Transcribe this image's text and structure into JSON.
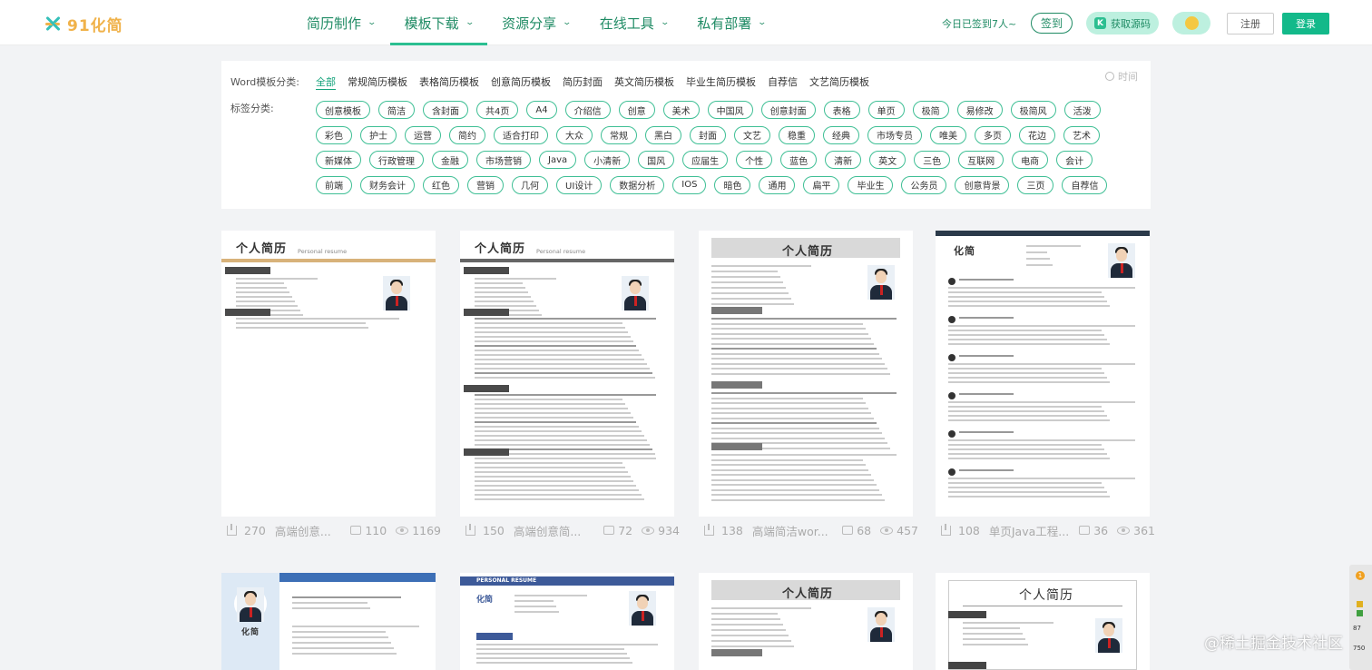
{
  "brand": {
    "logo_text": "91化简"
  },
  "nav": {
    "items": [
      {
        "label": "简历制作",
        "active": false
      },
      {
        "label": "模板下载",
        "active": true
      },
      {
        "label": "资源分享",
        "active": false
      },
      {
        "label": "在线工具",
        "active": false
      },
      {
        "label": "私有部署",
        "active": false
      }
    ]
  },
  "header": {
    "checkin_text": "今日已签到7人~",
    "checkin_button": "签到",
    "source_button": "获取源码",
    "register_button": "注册",
    "login_button": "登录"
  },
  "filter": {
    "word_label": "Word模板分类:",
    "tag_label": "标签分类:",
    "sort_label": "时间",
    "categories": [
      "全部",
      "常规简历模板",
      "表格简历模板",
      "创意简历模板",
      "简历封面",
      "英文简历模板",
      "毕业生简历模板",
      "自荐信",
      "文艺简历模板"
    ],
    "active_category": "全部",
    "tag_rows": [
      [
        "创意模板",
        "简洁",
        "含封面",
        "共4页",
        "A4",
        "介绍信",
        "创意",
        "美术",
        "中国风",
        "创意封面",
        "表格",
        "单页",
        "极简",
        "易修改",
        "极简风",
        "活泼"
      ],
      [
        "彩色",
        "护士",
        "运营",
        "简约",
        "适合打印",
        "大众",
        "常规",
        "黑白",
        "封面",
        "文艺",
        "稳重",
        "经典",
        "市场专员",
        "唯美",
        "多页",
        "花边",
        "艺术"
      ],
      [
        "新媒体",
        "行政管理",
        "金融",
        "市场营销",
        "Java",
        "小清新",
        "国风",
        "应届生",
        "个性",
        "蓝色",
        "清新",
        "英文",
        "三色",
        "互联网",
        "电商",
        "会计"
      ],
      [
        "前端",
        "财务会计",
        "红色",
        "营销",
        "几何",
        "UI设计",
        "数据分析",
        "IOS",
        "暗色",
        "通用",
        "扁平",
        "毕业生",
        "公务员",
        "创意背景",
        "三页",
        "自荐信"
      ]
    ]
  },
  "templates": [
    {
      "title_text": "个人简历",
      "subtitle": "Personal resume",
      "name": "高端创意...",
      "downloads": "270",
      "comments": "110",
      "views": "1169"
    },
    {
      "title_text": "个人简历",
      "subtitle": "Personal resume",
      "name": "高端创意简...",
      "downloads": "150",
      "comments": "72",
      "views": "934"
    },
    {
      "title_text": "个人简历",
      "subtitle": "",
      "name": "高端简洁wor...",
      "downloads": "138",
      "comments": "68",
      "views": "457"
    },
    {
      "title_text": "化简",
      "subtitle": "",
      "name": "单页Java工程...",
      "downloads": "108",
      "comments": "36",
      "views": "361"
    },
    {
      "title_text": "化简",
      "subtitle": "",
      "name": "",
      "downloads": "",
      "comments": "",
      "views": ""
    },
    {
      "title_text": "PERSONAL RESUME",
      "subtitle": "化简",
      "name": "",
      "downloads": "",
      "comments": "",
      "views": ""
    },
    {
      "title_text": "个人简历",
      "subtitle": "",
      "name": "",
      "downloads": "",
      "comments": "",
      "views": ""
    },
    {
      "title_text": "个人简历",
      "subtitle": "",
      "name": "",
      "downloads": "",
      "comments": "",
      "views": ""
    }
  ],
  "side_widget": {
    "badge": "1",
    "value1": "87",
    "value2": "750"
  },
  "watermark": "@稀土掘金技术社区",
  "colors": {
    "brand_green": "#1f8b64",
    "accent": "#13b98a",
    "tag_border": "#3fbf95"
  }
}
